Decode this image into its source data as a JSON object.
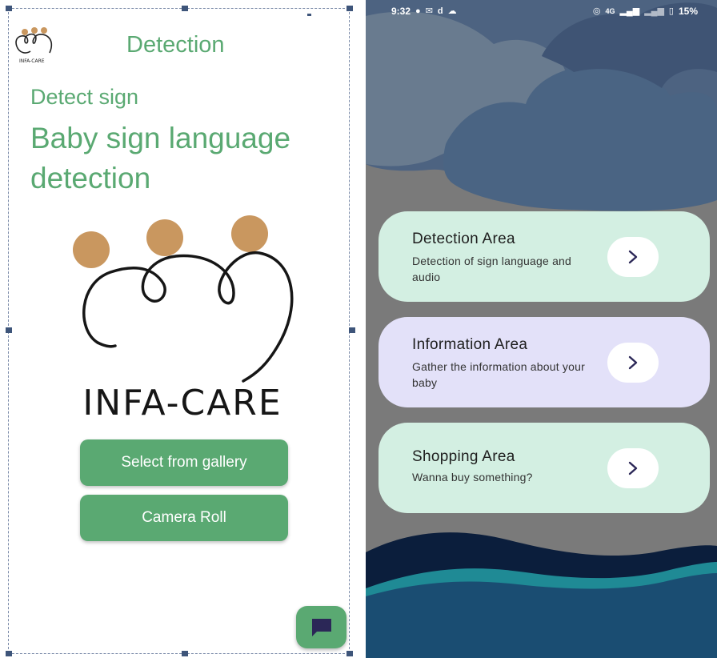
{
  "left": {
    "header_title": "Detection",
    "subtitle": "Detect sign",
    "headline": "Baby sign language detection",
    "logo_small_text": "INFA-CARE",
    "logo_text": "INFA-CARE",
    "buttons": {
      "gallery": "Select from gallery",
      "camera": "Camera Roll"
    },
    "chat_icon": "chat-bubble-icon",
    "colors": {
      "accent": "#5aa972",
      "logo_dots": "#c9975f"
    }
  },
  "right": {
    "status": {
      "time": "9:32",
      "icons_left": [
        "facebook-icon",
        "gmail-icon",
        "d-icon",
        "cloud-icon"
      ],
      "network": "4G",
      "battery": "15%"
    },
    "cards": [
      {
        "title": "Detection Area",
        "desc": "Detection of sign language and audio",
        "color": "#d3efe2"
      },
      {
        "title": "Information Area",
        "desc": "Gather the information about your baby",
        "color": "#e3e1f9"
      },
      {
        "title": "Shopping Area",
        "desc": "Wanna buy something?",
        "color": "#d3efe2"
      }
    ],
    "colors": {
      "background": "#7a7a7a",
      "clouds": "#4d6381",
      "wave_dark": "#0b1e3c",
      "wave_teal": "#1f8a95",
      "wave_blue": "#1a4d72"
    }
  }
}
